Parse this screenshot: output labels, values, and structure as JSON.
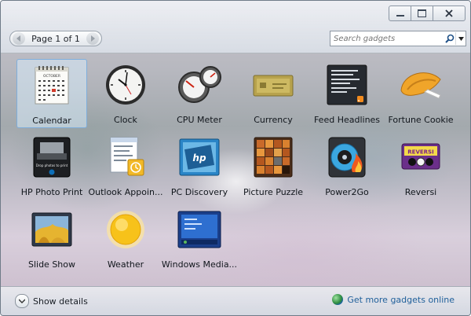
{
  "window": {
    "pager_text": "Page 1 of 1",
    "search_placeholder": "Search gadgets"
  },
  "gadgets": [
    {
      "label": "Calendar",
      "icon": "calendar-icon",
      "selected": true
    },
    {
      "label": "Clock",
      "icon": "clock-icon"
    },
    {
      "label": "CPU Meter",
      "icon": "cpu-meter-icon"
    },
    {
      "label": "Currency",
      "icon": "currency-icon"
    },
    {
      "label": "Feed Headlines",
      "icon": "feed-headlines-icon"
    },
    {
      "label": "Fortune Cookie",
      "icon": "fortune-cookie-icon"
    },
    {
      "label": "HP Photo Print",
      "icon": "hp-photo-print-icon"
    },
    {
      "label": "Outlook Appoin...",
      "icon": "outlook-appointments-icon"
    },
    {
      "label": "PC Discovery",
      "icon": "pc-discovery-icon"
    },
    {
      "label": "Picture Puzzle",
      "icon": "picture-puzzle-icon"
    },
    {
      "label": "Power2Go",
      "icon": "power2go-icon"
    },
    {
      "label": "Reversi",
      "icon": "reversi-icon"
    },
    {
      "label": "Slide Show",
      "icon": "slide-show-icon"
    },
    {
      "label": "Weather",
      "icon": "weather-icon"
    },
    {
      "label": "Windows Media...",
      "icon": "windows-media-center-icon"
    }
  ],
  "icon_text": {
    "calendar_month": "OCTOBER",
    "hp_logo": "hp",
    "reversi_logo": "REVERSI",
    "drop_text": "Drop photos to print"
  },
  "footer": {
    "show_details": "Show details",
    "get_more": "Get more gadgets online"
  },
  "colors": {
    "accent": "#1f5f9a",
    "selection": "#78aadc"
  }
}
